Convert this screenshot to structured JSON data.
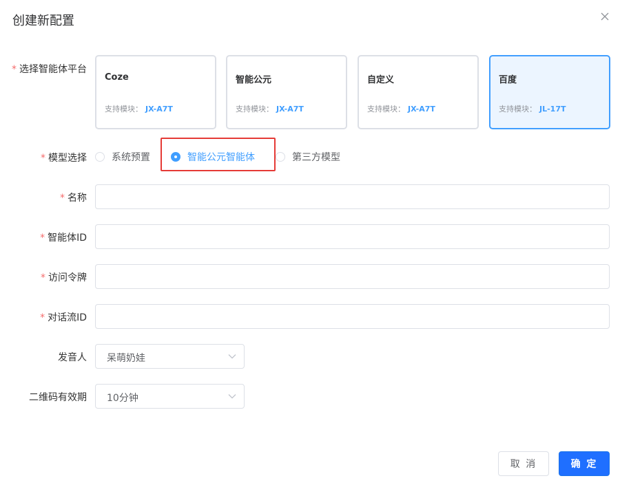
{
  "dialog": {
    "title": "创建新配置"
  },
  "form": {
    "platform": {
      "label": "选择智能体平台",
      "required_mark": "*",
      "cards": [
        {
          "name": "Coze",
          "module_label": "支持模块：",
          "module": "JX-A7T",
          "selected": false
        },
        {
          "name": "智能公元",
          "module_label": "支持模块：",
          "module": "JX-A7T",
          "selected": false
        },
        {
          "name": "自定义",
          "module_label": "支持模块：",
          "module": "JX-A7T",
          "selected": false
        },
        {
          "name": "百度",
          "module_label": "支持模块：",
          "module": "JL-17T",
          "selected": true
        }
      ]
    },
    "model": {
      "label": "模型选择",
      "required_mark": "*",
      "options": [
        {
          "label": "系统预置",
          "checked": false
        },
        {
          "label": "智能公元智能体",
          "checked": true
        },
        {
          "label": "第三方模型",
          "checked": false
        }
      ]
    },
    "name": {
      "label": "名称",
      "required_mark": "*",
      "value": "",
      "placeholder": ""
    },
    "agent_id": {
      "label": "智能体ID",
      "required_mark": "*",
      "value": "",
      "placeholder": ""
    },
    "access_token": {
      "label": "访问令牌",
      "required_mark": "*",
      "value": "",
      "placeholder": ""
    },
    "flow_id": {
      "label": "对话流ID",
      "required_mark": "*",
      "value": "",
      "placeholder": ""
    },
    "speaker": {
      "label": "发音人",
      "value": "呆萌奶娃"
    },
    "qr_validity": {
      "label": "二维码有效期",
      "value": "10分钟"
    }
  },
  "footer": {
    "cancel_label": "取 消",
    "ok_label": "确 定"
  },
  "colors": {
    "primary": "#1f6fff",
    "selected_border": "#409eff",
    "required": "#f56c6c",
    "highlight": "#e53935"
  }
}
